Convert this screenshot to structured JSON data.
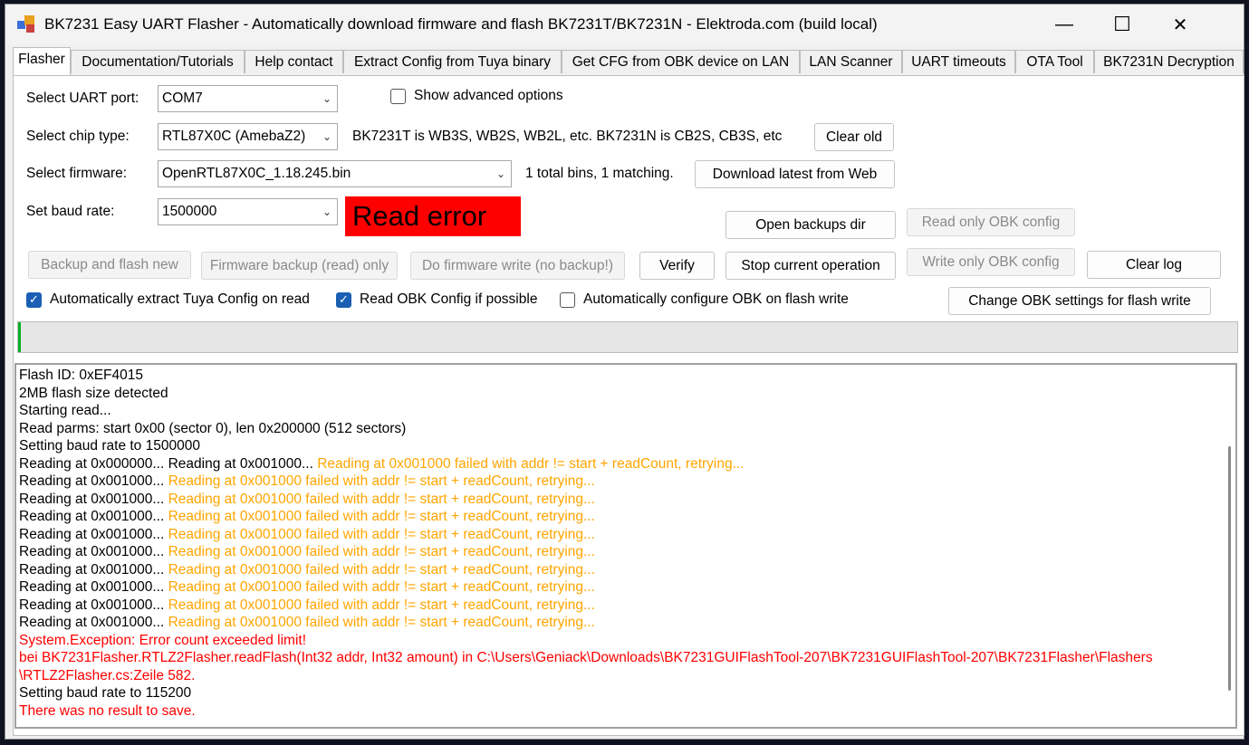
{
  "window": {
    "title": "BK7231 Easy UART Flasher - Automatically download firmware and flash BK7231T/BK7231N  - Elektroda.com (build local)",
    "minimize": "—",
    "maximize": "☐",
    "close": "✕"
  },
  "tabs": [
    "Flasher",
    "Documentation/Tutorials",
    "Help contact",
    "Extract Config from Tuya binary",
    "Get CFG from OBK device on LAN",
    "LAN Scanner",
    "UART timeouts",
    "OTA Tool",
    "BK7231N Decryption"
  ],
  "form": {
    "uart_label": "Select UART port:",
    "uart_value": "COM7",
    "advanced_label": "Show advanced options",
    "chip_label": "Select chip type:",
    "chip_value": "RTL87X0C (AmebaZ2)",
    "chip_hint": "BK7231T is WB3S, WB2S, WB2L, etc. BK7231N is CB2S, CB3S, etc",
    "clear_old": "Clear old",
    "firmware_label": "Select firmware:",
    "firmware_value": "OpenRTL87X0C_1.18.245.bin",
    "firmware_count": "1 total bins, 1 matching.",
    "download_latest": "Download latest from Web",
    "baud_label": "Set baud rate:",
    "baud_value": "1500000",
    "status": "Read error"
  },
  "buttons": {
    "open_backups": "Open backups dir",
    "read_only_obk": "Read only OBK config",
    "backup_flash": "Backup and flash new",
    "firmware_backup": "Firmware backup (read) only",
    "do_write": "Do firmware write (no backup!)",
    "verify": "Verify",
    "stop": "Stop current operation",
    "write_only_obk": "Write only OBK config",
    "clear_log": "Clear log",
    "change_obk": "Change OBK settings for flash write"
  },
  "checkboxes": {
    "extract_tuya": "Automatically extract Tuya Config on read",
    "read_obk": "Read OBK Config if possible",
    "auto_config": "Automatically configure OBK on flash write"
  },
  "progress_fraction": 0.002,
  "log": [
    {
      "parts": [
        {
          "t": "Flash ID: 0xEF4015",
          "c": "n"
        }
      ]
    },
    {
      "parts": [
        {
          "t": "2MB flash size detected",
          "c": "n"
        }
      ]
    },
    {
      "parts": [
        {
          "t": "Starting read...",
          "c": "n"
        }
      ]
    },
    {
      "parts": [
        {
          "t": "Read parms: start 0x00 (sector 0), len 0x200000 (512 sectors)",
          "c": "n"
        }
      ]
    },
    {
      "parts": [
        {
          "t": "Setting baud rate to 1500000",
          "c": "n"
        }
      ]
    },
    {
      "parts": [
        {
          "t": "Reading at 0x000000... Reading at 0x001000... ",
          "c": "n"
        },
        {
          "t": "Reading at 0x001000 failed with addr != start + readCount, retrying...",
          "c": "w"
        }
      ]
    },
    {
      "parts": [
        {
          "t": "Reading at 0x001000... ",
          "c": "n"
        },
        {
          "t": "Reading at 0x001000 failed with addr != start + readCount, retrying...",
          "c": "w"
        }
      ]
    },
    {
      "parts": [
        {
          "t": "Reading at 0x001000... ",
          "c": "n"
        },
        {
          "t": "Reading at 0x001000 failed with addr != start + readCount, retrying...",
          "c": "w"
        }
      ]
    },
    {
      "parts": [
        {
          "t": "Reading at 0x001000... ",
          "c": "n"
        },
        {
          "t": "Reading at 0x001000 failed with addr != start + readCount, retrying...",
          "c": "w"
        }
      ]
    },
    {
      "parts": [
        {
          "t": "Reading at 0x001000... ",
          "c": "n"
        },
        {
          "t": "Reading at 0x001000 failed with addr != start + readCount, retrying...",
          "c": "w"
        }
      ]
    },
    {
      "parts": [
        {
          "t": "Reading at 0x001000... ",
          "c": "n"
        },
        {
          "t": "Reading at 0x001000 failed with addr != start + readCount, retrying...",
          "c": "w"
        }
      ]
    },
    {
      "parts": [
        {
          "t": "Reading at 0x001000... ",
          "c": "n"
        },
        {
          "t": "Reading at 0x001000 failed with addr != start + readCount, retrying...",
          "c": "w"
        }
      ]
    },
    {
      "parts": [
        {
          "t": "Reading at 0x001000... ",
          "c": "n"
        },
        {
          "t": "Reading at 0x001000 failed with addr != start + readCount, retrying...",
          "c": "w"
        }
      ]
    },
    {
      "parts": [
        {
          "t": "Reading at 0x001000... ",
          "c": "n"
        },
        {
          "t": "Reading at 0x001000 failed with addr != start + readCount, retrying...",
          "c": "w"
        }
      ]
    },
    {
      "parts": [
        {
          "t": "Reading at 0x001000... ",
          "c": "n"
        },
        {
          "t": "Reading at 0x001000 failed with addr != start + readCount, retrying...",
          "c": "w"
        }
      ]
    },
    {
      "parts": [
        {
          "t": "System.Exception: Error count exceeded limit!",
          "c": "e"
        }
      ]
    },
    {
      "parts": [
        {
          "t": "   bei BK7231Flasher.RTLZ2Flasher.readFlash(Int32 addr, Int32 amount) in C:\\Users\\Geniack\\Downloads\\BK7231GUIFlashTool-207\\BK7231GUIFlashTool-207\\BK7231Flasher\\Flashers",
          "c": "e"
        }
      ]
    },
    {
      "parts": [
        {
          "t": "\\RTLZ2Flasher.cs:Zeile 582.",
          "c": "e"
        }
      ]
    },
    {
      "parts": [
        {
          "t": "Setting baud rate to 115200",
          "c": "n"
        }
      ]
    },
    {
      "parts": [
        {
          "t": "There was no result to save.",
          "c": "e"
        }
      ]
    }
  ]
}
